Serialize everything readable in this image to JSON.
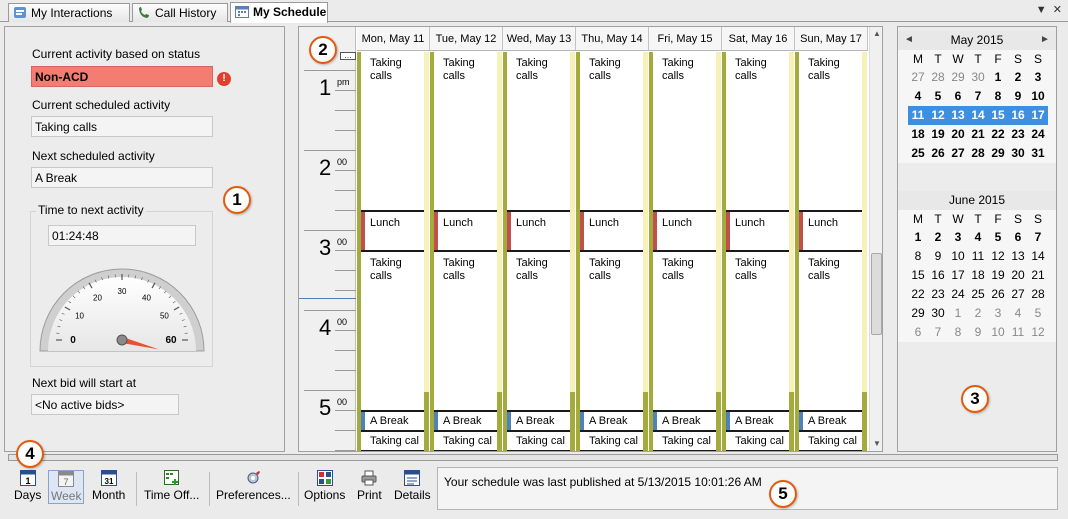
{
  "tabs": [
    {
      "label": "My Interactions",
      "icon": "interactions-icon",
      "active": false
    },
    {
      "label": "Call History",
      "icon": "call-history-icon",
      "active": false
    },
    {
      "label": "My Schedule",
      "icon": "schedule-icon",
      "active": true
    }
  ],
  "left_panel": {
    "current_activity_label": "Current activity based on status",
    "current_activity_value": "Non-ACD",
    "scheduled_activity_label": "Current scheduled activity",
    "scheduled_activity_value": "Taking calls",
    "next_activity_label": "Next scheduled activity",
    "next_activity_value": "A Break",
    "time_to_next_label": "Time to next activity",
    "time_to_next_value": "01:24:48",
    "gauge": {
      "ticks": [
        "0",
        "10",
        "20",
        "30",
        "40",
        "50",
        "60"
      ],
      "needle_value": 60,
      "max": 60
    },
    "next_bid_label": "Next bid will start at",
    "next_bid_value": "<No active bids>"
  },
  "schedule": {
    "days": [
      "Mon, May 11",
      "Tue, May 12",
      "Wed, May 13",
      "Thu, May 14",
      "Fri, May 15",
      "Sat, May 16",
      "Sun, May 17"
    ],
    "hours": [
      {
        "hour": "1",
        "sup": "pm"
      },
      {
        "hour": "2",
        "sup": "00"
      },
      {
        "hour": "3",
        "sup": "00"
      },
      {
        "hour": "4",
        "sup": "00"
      },
      {
        "hour": "5",
        "sup": "00"
      }
    ],
    "activities": [
      {
        "name": "Taking calls",
        "color": "#ffffff"
      },
      {
        "name": "Lunch",
        "color": "#c0504d"
      },
      {
        "name": "Taking calls",
        "color": "#ffffff"
      },
      {
        "name": "A Break",
        "color": "#4f81bd"
      },
      {
        "name": "Taking cal",
        "color": "#ffffff"
      }
    ]
  },
  "calendars": [
    {
      "title": "May 2015",
      "dow": [
        "M",
        "T",
        "W",
        "T",
        "F",
        "S",
        "S"
      ],
      "weeks": [
        [
          "27",
          "28",
          "29",
          "30",
          "1",
          "2",
          "3"
        ],
        [
          "4",
          "5",
          "6",
          "7",
          "8",
          "9",
          "10"
        ],
        [
          "11",
          "12",
          "13",
          "14",
          "15",
          "16",
          "17"
        ],
        [
          "18",
          "19",
          "20",
          "21",
          "22",
          "23",
          "24"
        ],
        [
          "25",
          "26",
          "27",
          "28",
          "29",
          "30",
          "31"
        ]
      ]
    },
    {
      "title": "June 2015",
      "dow": [
        "M",
        "T",
        "W",
        "T",
        "F",
        "S",
        "S"
      ],
      "weeks": [
        [
          "1",
          "2",
          "3",
          "4",
          "5",
          "6",
          "7"
        ],
        [
          "8",
          "9",
          "10",
          "11",
          "12",
          "13",
          "14"
        ],
        [
          "15",
          "16",
          "17",
          "18",
          "19",
          "20",
          "21"
        ],
        [
          "22",
          "23",
          "24",
          "25",
          "26",
          "27",
          "28"
        ],
        [
          "29",
          "30",
          "1",
          "2",
          "3",
          "4",
          "5"
        ],
        [
          "6",
          "7",
          "8",
          "9",
          "10",
          "11",
          "12"
        ]
      ]
    }
  ],
  "toolbar": {
    "days": "Days",
    "week": "Week",
    "month": "Month",
    "time_off": "Time Off...",
    "preferences": "Preferences...",
    "options": "Options",
    "print": "Print",
    "details": "Details",
    "days_icon_text": "1",
    "week_icon_text": "7",
    "month_icon_text": "31"
  },
  "status_message": "Your schedule was last published at 5/13/2015 10:01:26 AM",
  "callouts": [
    "1",
    "2",
    "3",
    "4",
    "5"
  ],
  "colors": {
    "work_strip": "#a2ab3b",
    "non_acd": "#f47c71",
    "lunch": "#c0504d",
    "break": "#4f81bd",
    "selected_week": "#3f8fe0"
  }
}
